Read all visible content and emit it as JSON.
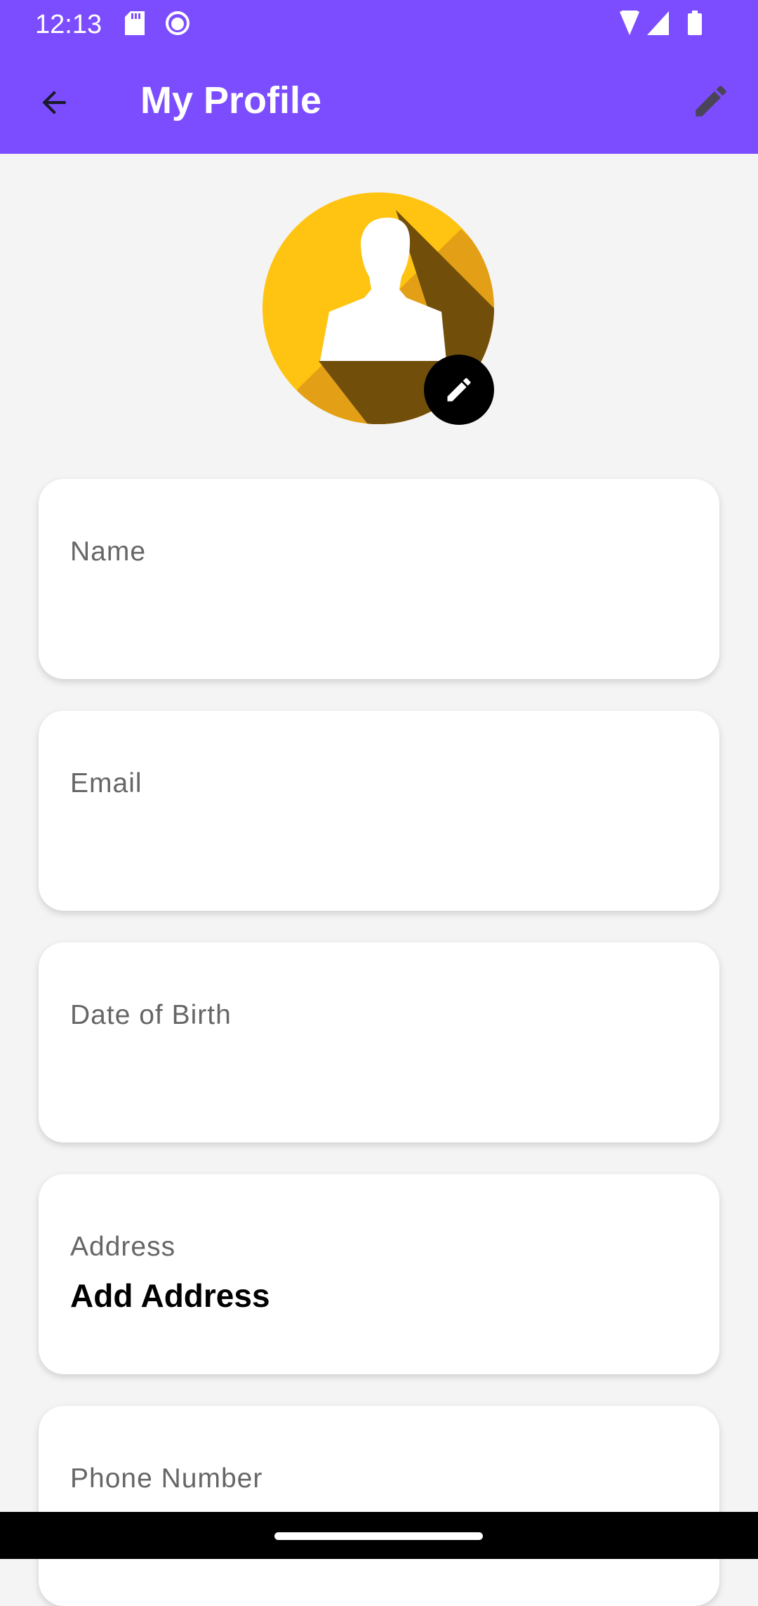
{
  "status_bar": {
    "time": "12:13"
  },
  "app_bar": {
    "title": "My Profile"
  },
  "fields": [
    {
      "label": "Name",
      "value": ""
    },
    {
      "label": "Email",
      "value": ""
    },
    {
      "label": "Date of Birth",
      "value": ""
    },
    {
      "label": "Address",
      "value": "Add Address"
    },
    {
      "label": "Phone Number",
      "value": ""
    }
  ],
  "colors": {
    "primary": "#7c4dff",
    "avatar": "#ffc311"
  }
}
